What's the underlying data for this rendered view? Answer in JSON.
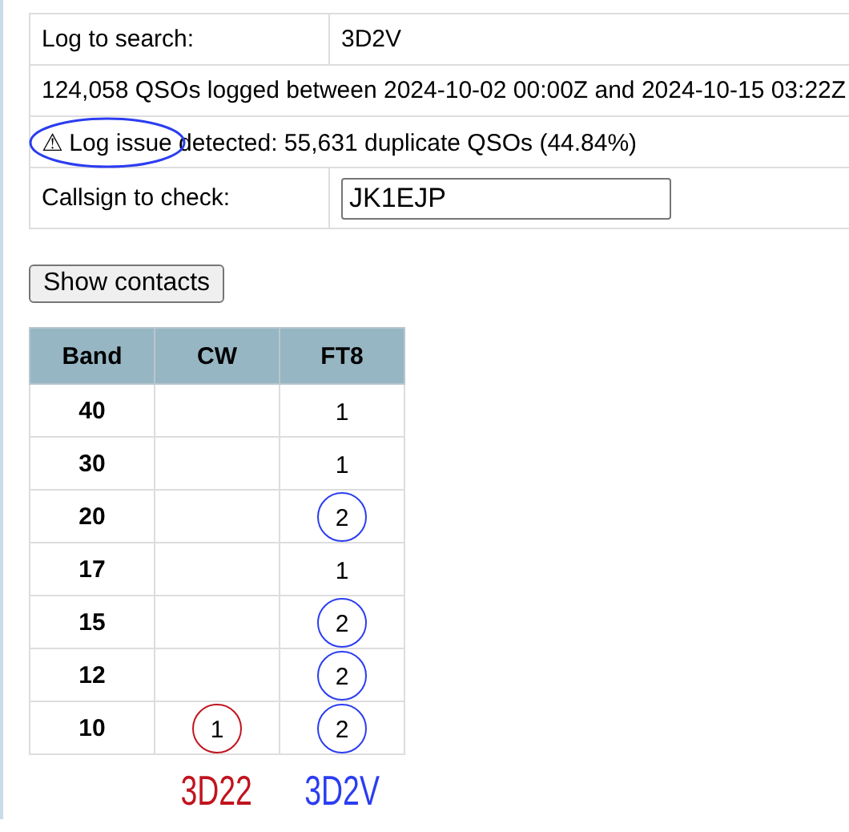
{
  "form": {
    "rows": [
      {
        "kind": "pair",
        "label": "Log to search:",
        "value": "3D2V"
      },
      {
        "kind": "note",
        "text": "124,058 QSOs logged between 2024-10-02 00:00Z and 2024-10-15 03:22Z"
      },
      {
        "kind": "warning",
        "icon": "⚠",
        "text": "Log issue detected: 55,631 duplicate QSOs (44.84%)",
        "color": "#2b3df0"
      },
      {
        "kind": "input",
        "label": "Callsign to check:",
        "value": "JK1EJP"
      }
    ]
  },
  "button": "Show contacts",
  "band_table": {
    "columns": [
      "Band",
      "CW",
      "FT8"
    ],
    "rows": [
      {
        "cells": [
          {
            "text": "40"
          },
          {
            "text": ""
          },
          {
            "text": "1"
          }
        ]
      },
      {
        "cells": [
          {
            "text": "30"
          },
          {
            "text": ""
          },
          {
            "text": "1"
          }
        ]
      },
      {
        "cells": [
          {
            "text": "20"
          },
          {
            "text": ""
          },
          {
            "text": "2",
            "color": "#2b3df0"
          }
        ]
      },
      {
        "cells": [
          {
            "text": "17"
          },
          {
            "text": ""
          },
          {
            "text": "1"
          }
        ]
      },
      {
        "cells": [
          {
            "text": "15"
          },
          {
            "text": ""
          },
          {
            "text": "2",
            "color": "#2b3df0"
          }
        ]
      },
      {
        "cells": [
          {
            "text": "12"
          },
          {
            "text": ""
          },
          {
            "text": "2",
            "color": "#2b3df0"
          }
        ]
      },
      {
        "cells": [
          {
            "text": "10"
          },
          {
            "text": "1",
            "color": "#c0141e"
          },
          {
            "text": "2",
            "color": "#2b3df0"
          }
        ]
      }
    ]
  },
  "legend": [
    {
      "text": "3D22",
      "color": "#c0141e"
    },
    {
      "text": "3D2V",
      "color": "#2b3df0"
    }
  ]
}
